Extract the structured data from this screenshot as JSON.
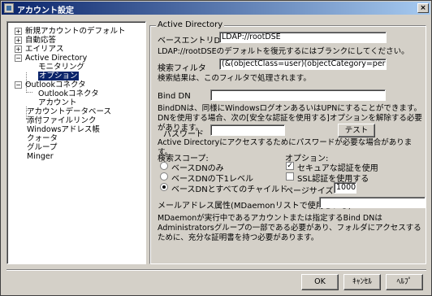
{
  "window": {
    "title": "アカウント設定",
    "close_label": "×"
  },
  "tree": {
    "items": [
      {
        "label": "新規アカウントのデフォルト",
        "expander": "+"
      },
      {
        "label": "自動応答",
        "expander": "+"
      },
      {
        "label": "エイリアス",
        "expander": "+"
      },
      {
        "label": "Active Directory",
        "expander": "−"
      },
      {
        "label": "モニタリング",
        "expander": ""
      },
      {
        "label": "オプション",
        "expander": ""
      },
      {
        "label": "Outlookコネクタ",
        "expander": "−"
      },
      {
        "label": "Outlookコネクタ",
        "expander": ""
      },
      {
        "label": "アカウント",
        "expander": ""
      },
      {
        "label": "アカウントデータベース",
        "expander": ""
      },
      {
        "label": "添付ファイルリンク",
        "expander": ""
      },
      {
        "label": "Windowsアドレス帳",
        "expander": ""
      },
      {
        "label": "クォータ",
        "expander": ""
      },
      {
        "label": "グループ",
        "expander": ""
      },
      {
        "label": "Minger",
        "expander": ""
      }
    ]
  },
  "ad": {
    "group_title": "Active Directory",
    "base_dn_label": "ベースエントリDN",
    "base_dn_value": "LDAP://rootDSE",
    "base_dn_note": "LDAP://rootDSEのデフォルトを復元するにはブランクにしてください。",
    "filter_label": "検索フィルタ",
    "filter_value": "(&(objectClass=user)(objectCategory=person))",
    "filter_note": "検索結果は、このフィルタで処理されます。",
    "bind_dn_label": "Bind DN",
    "bind_dn_value": "",
    "bind_dn_note": "BindDNは、同様にWindowsログオンあるいはUPNにすることができます。DNを使用する場合、次の[安全な認証を使用する]オプションを解除する必要があります。",
    "password_label": "パスワード",
    "password_value": "",
    "test_button": "テスト",
    "access_note": "Active Directoryにアクセスするためにパスワードが必要な場合があります。",
    "scope_label": "検索スコープ:",
    "scope_options": [
      "ベースDNのみ",
      "ベースDNの下1レベル",
      "ベースDNとすべてのチャイルド"
    ],
    "options_label": "オプション:",
    "secure_auth_label": "セキュアな認証を使用",
    "ssl_label": "SSL認証を使用する",
    "page_size_label": "ページサイズ",
    "page_size_value": "1000",
    "mail_attr_label": "メールアドレス属性(MDaemonリストで使用される)",
    "mail_attr_value": "",
    "bottom_note": "MDaemonが実行中であるアカウントまたは指定するBind DNはAdministratorsグループの一部である必要があり、フォルダにアクセスするために、充分な証明書を持つ必要があります。"
  },
  "buttons": {
    "ok": "OK",
    "cancel": "ｷｬﾝｾﾙ",
    "help": "ﾍﾙﾌﾟ"
  }
}
